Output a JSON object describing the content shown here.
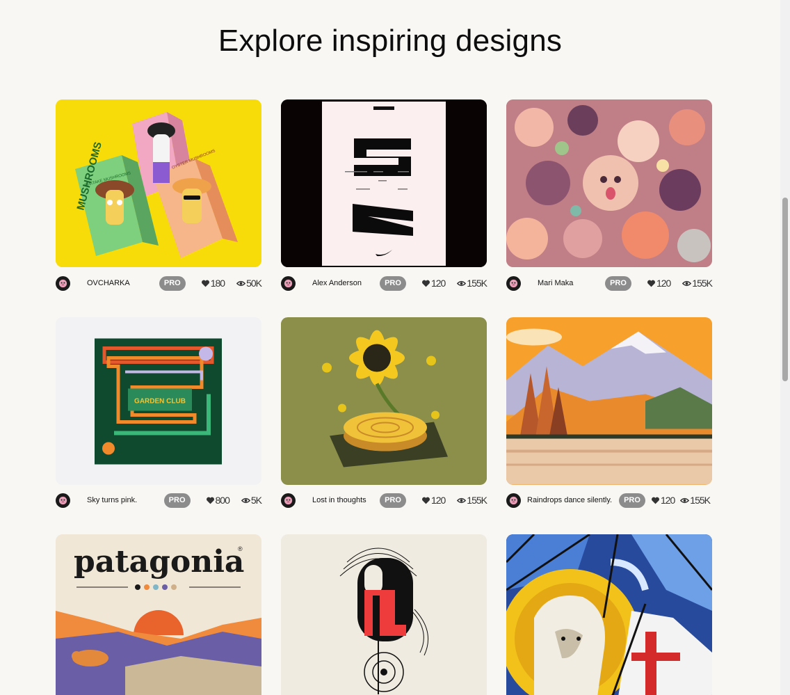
{
  "page": {
    "title": "Explore inspiring designs"
  },
  "cards": [
    {
      "author": "OVCHARKA",
      "badge": "PRO",
      "likes": "180",
      "views": "50K",
      "art": "mushroom-packaging"
    },
    {
      "author": "Alex Anderson",
      "badge": "PRO",
      "likes": "120",
      "views": "155K",
      "art": "nike-poster"
    },
    {
      "author": "Mari Maka",
      "badge": "PRO",
      "likes": "120",
      "views": "155K",
      "art": "floral-faces"
    },
    {
      "author": "Sky turns pink.",
      "badge": "PRO",
      "likes": "800",
      "views": "5K",
      "art": "garden-club"
    },
    {
      "author": "Lost in thoughts",
      "badge": "PRO",
      "likes": "120",
      "views": "155K",
      "art": "sunflower-turntable"
    },
    {
      "author": "Raindrops dance silently.",
      "badge": "PRO",
      "likes": "120",
      "views": "155K",
      "art": "mountain-lake"
    },
    {
      "author": "",
      "badge": "",
      "likes": "",
      "views": "",
      "art": "patagonia-poster",
      "brand_text": "patagonia",
      "brand_mark": "®"
    },
    {
      "author": "",
      "badge": "",
      "likes": "",
      "views": "",
      "art": "abstract-figure"
    },
    {
      "author": "",
      "badge": "",
      "likes": "",
      "views": "",
      "art": "stained-glass"
    }
  ],
  "art_text": {
    "garden_club": "GARDEN CLUB",
    "mushrooms": "MUSHROOMS",
    "shiitake": "SHIITAKE MUSHROOMS",
    "oyster": "OYSTER MUSHROOMS"
  },
  "colors": {
    "background": "#f8f7f4",
    "pro_badge": "#8c8c8c",
    "avatar": "#1a1a1a",
    "avatar_face": "#e8a0b8"
  }
}
